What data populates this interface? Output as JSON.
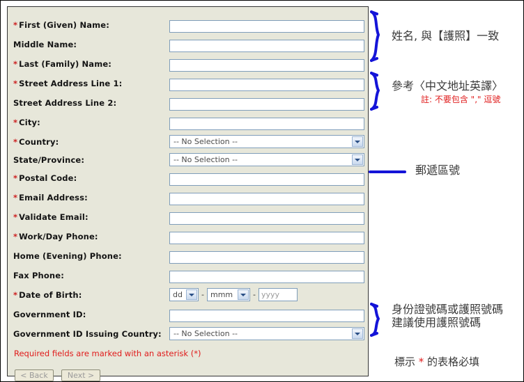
{
  "form": {
    "fields": [
      {
        "label": "First (Given) Name:",
        "required": true,
        "control": "text"
      },
      {
        "label": "Middle Name:",
        "required": false,
        "control": "text"
      },
      {
        "label": "Last (Family) Name:",
        "required": true,
        "control": "text"
      },
      {
        "label": "Street Address Line 1:",
        "required": true,
        "control": "text"
      },
      {
        "label": "Street Address Line 2:",
        "required": false,
        "control": "text"
      },
      {
        "label": "City:",
        "required": true,
        "control": "text"
      },
      {
        "label": "Country:",
        "required": true,
        "control": "select",
        "value": "-- No Selection --"
      },
      {
        "label": "State/Province:",
        "required": false,
        "control": "select",
        "value": "-- No Selection --"
      },
      {
        "label": "Postal Code:",
        "required": true,
        "control": "text"
      },
      {
        "label": "Email Address:",
        "required": true,
        "control": "text"
      },
      {
        "label": "Validate Email:",
        "required": true,
        "control": "text"
      },
      {
        "label": "Work/Day Phone:",
        "required": true,
        "control": "text"
      },
      {
        "label": "Home (Evening) Phone:",
        "required": false,
        "control": "text"
      },
      {
        "label": "Fax Phone:",
        "required": false,
        "control": "text"
      },
      {
        "label": "Date of Birth:",
        "required": true,
        "control": "dob"
      },
      {
        "label": "Government ID:",
        "required": false,
        "control": "text"
      },
      {
        "label": "Government ID Issuing Country:",
        "required": false,
        "control": "select",
        "value": "-- No Selection --"
      }
    ],
    "dob": {
      "day_value": "dd",
      "month_value": "mmm",
      "year_placeholder": "yyyy",
      "separator": "-"
    },
    "required_note": "Required fields are marked with an asterisk (*)",
    "buttons": {
      "back_label": "< Back",
      "next_label": "Next >"
    },
    "asterisk": "*",
    "colors": {
      "panel_background": "#e7e7da",
      "panel_border": "#333333",
      "input_border": "#7f9dba",
      "required_red": "#e01b1b",
      "label_text": "#141414"
    }
  },
  "annotations": {
    "name_note": "姓名, 與【護照】一致",
    "address_note": "參考〈中文地址英譯〉",
    "address_warning": "註: 不要包含 \",\" 逗號",
    "postal_note": "郵遞區號",
    "gov_id_note_line1": "身份證號碼或護照號碼",
    "gov_id_note_line2": "建議使用護照號碼",
    "asterisk_note_pre": "標示 ",
    "asterisk_note_star": "*",
    "asterisk_note_post": " 的表格必填",
    "marker_color": "#1414d8"
  }
}
